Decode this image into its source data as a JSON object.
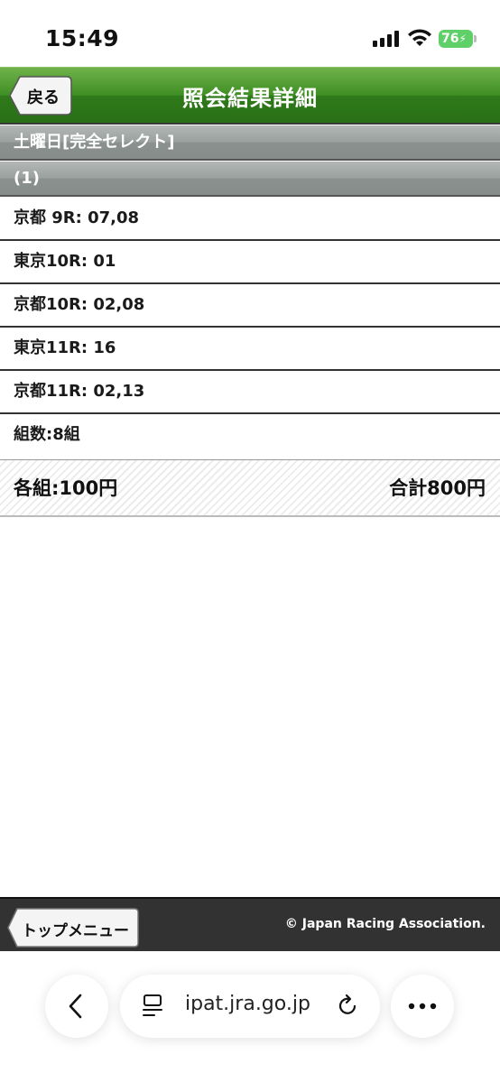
{
  "status_bar": {
    "time": "15:49",
    "battery": "76"
  },
  "header": {
    "back_label": "戻る",
    "title": "照会結果詳細"
  },
  "sections": {
    "bet_type": "土曜日[完全セレクト]",
    "group": "(1)"
  },
  "rows": [
    "京都  9R: 07,08",
    "東京10R: 01",
    "京都10R: 02,08",
    "東京11R: 16",
    "京都11R: 02,13",
    "組数:8組"
  ],
  "totals": {
    "per_unit": "各組:100円",
    "total": "合計800円"
  },
  "footer": {
    "top_menu_label": "トップメニュー",
    "copyright": "© Japan Racing Association."
  },
  "browser": {
    "url": "ipat.jra.go.jp"
  },
  "colors": {
    "header_green": "#3f8f25",
    "section_grey": "#9aa09e",
    "battery_green": "#5fcf68",
    "footer_dark": "#323232"
  }
}
